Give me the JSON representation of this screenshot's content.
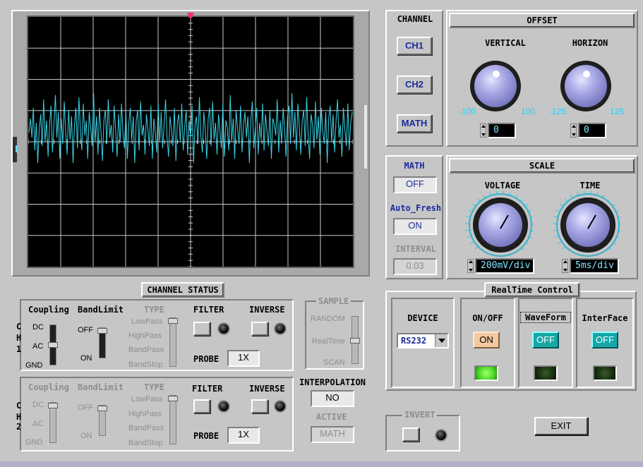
{
  "colors": {
    "trace": "#3ad4e6",
    "grid": "#c8c8c8",
    "screen": "#000000",
    "accent_button_text": "#1c2a9c",
    "scale_label": "#1ed3ff"
  },
  "channel_panel": {
    "title": "CHANNEL",
    "buttons": [
      "CH1",
      "CH2",
      "MATH"
    ]
  },
  "offset": {
    "title": "OFFSET",
    "vertical": {
      "label": "VERTICAL",
      "min": "-100",
      "max": "100",
      "value": "0"
    },
    "horizon": {
      "label": "HORIZON",
      "min": "-125",
      "max": "125",
      "value": "0"
    }
  },
  "math_panel": {
    "math_label": "MATH",
    "math_value": "OFF",
    "autofresh_label": "Auto_Fresh",
    "autofresh_value": "ON",
    "interval_label": "INTERVAL",
    "interval_value": "0.03"
  },
  "scale": {
    "title": "SCALE",
    "voltage": {
      "label": "VOLTAGE",
      "value": "200mV/div"
    },
    "time": {
      "label": "TIME",
      "value": "5ms/div"
    }
  },
  "channel_status": {
    "title": "CHANNEL STATUS",
    "ch1": {
      "label_c": "C",
      "label_h": "H",
      "label_n": "1",
      "coupling": "Coupling",
      "bandlimit": "BandLimit",
      "type": "TYPE",
      "coupling_opts": [
        "DC",
        "AC",
        "GND"
      ],
      "bandlimit_opts": [
        "OFF",
        "ON"
      ],
      "type_opts": [
        "LowPass",
        "HighPass",
        "BandPass",
        "BandStop"
      ],
      "filter": "FILTER",
      "inverse": "INVERSE",
      "probe_label": "PROBE",
      "probe_value": "1X"
    },
    "ch2": {
      "label_c": "C",
      "label_h": "H",
      "label_n": "2",
      "coupling": "Coupling",
      "bandlimit": "BandLimit",
      "type": "TYPE",
      "coupling_opts": [
        "DC",
        "AC",
        "GND"
      ],
      "bandlimit_opts": [
        "OFF",
        "ON"
      ],
      "type_opts": [
        "LowPass",
        "HighPass",
        "BandPass",
        "BandStop"
      ],
      "filter": "FILTER",
      "inverse": "INVERSE",
      "probe_label": "PROBE",
      "probe_value": "1X"
    }
  },
  "sample": {
    "title": "SAMPLE",
    "opts": [
      "RANDOM",
      "RealTime",
      "SCAN"
    ]
  },
  "interpolation": {
    "label": "INTERPOLATION",
    "value": "NO",
    "active_label": "ACTIVE",
    "active_value": "MATH"
  },
  "realtime": {
    "title": "RealTime Control",
    "device_label": "DEVICE",
    "device_value": "RS232",
    "onoff_label": "ON/OFF",
    "onoff_value": "ON",
    "waveform_label": "WaveForm",
    "waveform_value": "OFF",
    "interface_label": "InterFace",
    "interface_value": "OFF"
  },
  "invert": {
    "title": "INVERT"
  },
  "exit_label": "EXIT",
  "trace_data": [
    0.02,
    0.35,
    -0.1,
    0.6,
    -0.4,
    0.25,
    -0.7,
    0.1,
    0.45,
    -0.3,
    0.8,
    -0.2,
    0.3,
    -0.55,
    0.15,
    0.65,
    -0.45,
    0.2,
    0.9,
    -0.1,
    0.5,
    -0.6,
    0.35,
    -0.25,
    0.75,
    0.05,
    -0.5,
    0.55,
    -0.15,
    0.4,
    -0.7,
    0.2,
    0.6,
    -0.35,
    0.85,
    0.1,
    -0.4,
    0.7,
    -0.05,
    0.3,
    -0.6,
    0.5,
    0.15,
    -0.3,
    0.95,
    -0.2,
    0.4,
    -0.5,
    0.6,
    0.05,
    -0.65,
    0.3,
    0.55,
    -0.25,
    0.8,
    -0.1,
    0.2,
    -0.45,
    0.65,
    0.1,
    -0.55,
    0.45,
    -0.2,
    0.7,
    0.0,
    -0.35,
    0.5,
    -0.6,
    0.25,
    0.6,
    -0.15,
    0.4,
    -0.7,
    0.3,
    0.55,
    -0.4,
    0.75,
    -0.05,
    0.2,
    -0.5,
    0.45,
    0.1,
    -0.3,
    0.65,
    -0.6,
    0.35,
    0.05,
    -0.45,
    0.7,
    -0.2,
    0.5,
    -0.35,
    0.2,
    0.8,
    -0.1,
    -0.55,
    0.4,
    0.1,
    -0.3,
    0.6,
    -0.65,
    0.25,
    0.45,
    -0.2,
    0.7,
    -0.4,
    0.15,
    0.55,
    -0.5,
    0.3,
    -0.1,
    0.65,
    -0.7,
    0.2,
    0.4,
    -0.25,
    0.85,
    -0.05,
    -0.45,
    0.5,
    0.1,
    -0.6,
    0.35,
    0.6,
    -0.3,
    0.75,
    -0.15,
    0.25,
    -0.5,
    0.45,
    0.05,
    -0.35,
    0.7,
    -0.55,
    0.3,
    0.15,
    -0.4,
    0.9,
    -0.2,
    0.35,
    -0.6,
    0.55,
    0.1,
    -0.25,
    0.65,
    -0.45,
    0.2,
    0.5,
    -0.1,
    0.4,
    -0.7,
    0.3,
    0.75,
    -0.35,
    0.1,
    0.6,
    -0.5,
    0.25,
    -0.15,
    0.7,
    -0.4,
    0.45,
    0.05,
    -0.3,
    0.55,
    -0.6,
    0.35,
    0.2,
    -0.05,
    0.8,
    -0.45,
    0.3,
    -0.2,
    0.6,
    0.1,
    -0.55,
    0.4,
    0.65,
    -0.25,
    0.95,
    -0.1,
    0.5,
    -0.4,
    0.7,
    0.15,
    -0.5,
    0.3,
    0.55,
    -0.3,
    0.85,
    0.0,
    -0.6,
    0.45,
    0.2,
    -0.35,
    0.75,
    -0.15,
    0.4,
    -0.5,
    0.6,
    0.05,
    -0.25,
    0.5,
    -0.7,
    0.35,
    0.65,
    -0.2,
    0.45,
    -0.45,
    0.3,
    0.8,
    -0.1,
    0.2,
    -0.55,
    0.6,
    0.1,
    -0.3,
    0.7,
    -0.4,
    0.25,
    0.5
  ]
}
